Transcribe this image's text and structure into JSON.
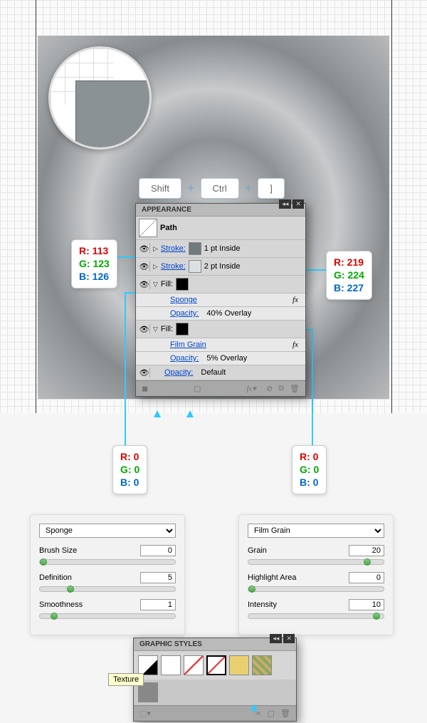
{
  "keys": {
    "shift": "Shift",
    "ctrl": "Ctrl",
    "bracket": "]"
  },
  "appearance": {
    "title": "APPEARANCE",
    "path": "Path",
    "rows": [
      {
        "label": "Stroke:",
        "val": "1 pt  Inside"
      },
      {
        "label": "Stroke:",
        "val": "2 pt  Inside"
      },
      {
        "label": "Fill:"
      },
      {
        "effect": "Sponge",
        "fx": "fx"
      },
      {
        "label": "Opacity:",
        "val": "40% Overlay"
      },
      {
        "label": "Fill:"
      },
      {
        "effect": "Film Grain",
        "fx": "fx"
      },
      {
        "label": "Opacity:",
        "val": "5% Overlay"
      },
      {
        "label": "Opacity:",
        "val": "Default"
      }
    ]
  },
  "rgb": {
    "left": {
      "r": "R: 113",
      "g": "G: 123",
      "b": "B: 126"
    },
    "right": {
      "r": "R: 219",
      "g": "G: 224",
      "b": "B: 227"
    },
    "black1": {
      "r": "R: 0",
      "g": "G: 0",
      "b": "B: 0"
    },
    "black2": {
      "r": "R: 0",
      "g": "G: 0",
      "b": "B: 0"
    }
  },
  "sponge": {
    "name": "Sponge",
    "params": [
      {
        "label": "Brush Size",
        "val": "0",
        "pos": "0%"
      },
      {
        "label": "Definition",
        "val": "5",
        "pos": "20%"
      },
      {
        "label": "Smoothness",
        "val": "1",
        "pos": "8%"
      }
    ]
  },
  "filmgrain": {
    "name": "Film Grain",
    "params": [
      {
        "label": "Grain",
        "val": "20",
        "pos": "85%"
      },
      {
        "label": "Highlight Area",
        "val": "0",
        "pos": "0%"
      },
      {
        "label": "Intensity",
        "val": "10",
        "pos": "92%"
      }
    ]
  },
  "graphic_styles": {
    "title": "GRAPHIC STYLES",
    "tooltip": "Texture"
  }
}
